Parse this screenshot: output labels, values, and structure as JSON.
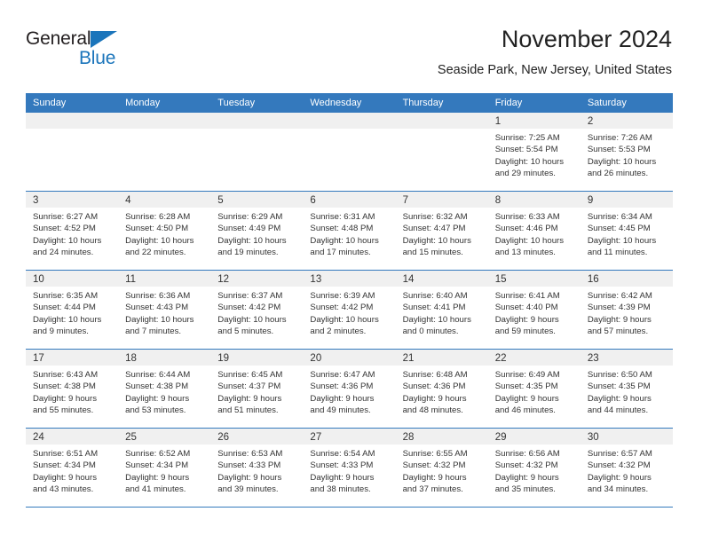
{
  "brand": {
    "name_part1": "General",
    "name_part2": "Blue",
    "accent_color": "#1b75bb",
    "logo_icon": "triangle-icon"
  },
  "header": {
    "title": "November 2024",
    "subtitle": "Seaside Park, New Jersey, United States"
  },
  "calendar": {
    "header_color": "#3479bd",
    "weekdays": [
      "Sunday",
      "Monday",
      "Tuesday",
      "Wednesday",
      "Thursday",
      "Friday",
      "Saturday"
    ],
    "weeks": [
      [
        {
          "day": "",
          "sunrise": "",
          "sunset": "",
          "daylight": "",
          "empty": true
        },
        {
          "day": "",
          "sunrise": "",
          "sunset": "",
          "daylight": "",
          "empty": true
        },
        {
          "day": "",
          "sunrise": "",
          "sunset": "",
          "daylight": "",
          "empty": true
        },
        {
          "day": "",
          "sunrise": "",
          "sunset": "",
          "daylight": "",
          "empty": true
        },
        {
          "day": "",
          "sunrise": "",
          "sunset": "",
          "daylight": "",
          "empty": true
        },
        {
          "day": "1",
          "sunrise": "Sunrise: 7:25 AM",
          "sunset": "Sunset: 5:54 PM",
          "daylight": "Daylight: 10 hours and 29 minutes.",
          "empty": false
        },
        {
          "day": "2",
          "sunrise": "Sunrise: 7:26 AM",
          "sunset": "Sunset: 5:53 PM",
          "daylight": "Daylight: 10 hours and 26 minutes.",
          "empty": false
        }
      ],
      [
        {
          "day": "3",
          "sunrise": "Sunrise: 6:27 AM",
          "sunset": "Sunset: 4:52 PM",
          "daylight": "Daylight: 10 hours and 24 minutes.",
          "empty": false
        },
        {
          "day": "4",
          "sunrise": "Sunrise: 6:28 AM",
          "sunset": "Sunset: 4:50 PM",
          "daylight": "Daylight: 10 hours and 22 minutes.",
          "empty": false
        },
        {
          "day": "5",
          "sunrise": "Sunrise: 6:29 AM",
          "sunset": "Sunset: 4:49 PM",
          "daylight": "Daylight: 10 hours and 19 minutes.",
          "empty": false
        },
        {
          "day": "6",
          "sunrise": "Sunrise: 6:31 AM",
          "sunset": "Sunset: 4:48 PM",
          "daylight": "Daylight: 10 hours and 17 minutes.",
          "empty": false
        },
        {
          "day": "7",
          "sunrise": "Sunrise: 6:32 AM",
          "sunset": "Sunset: 4:47 PM",
          "daylight": "Daylight: 10 hours and 15 minutes.",
          "empty": false
        },
        {
          "day": "8",
          "sunrise": "Sunrise: 6:33 AM",
          "sunset": "Sunset: 4:46 PM",
          "daylight": "Daylight: 10 hours and 13 minutes.",
          "empty": false
        },
        {
          "day": "9",
          "sunrise": "Sunrise: 6:34 AM",
          "sunset": "Sunset: 4:45 PM",
          "daylight": "Daylight: 10 hours and 11 minutes.",
          "empty": false
        }
      ],
      [
        {
          "day": "10",
          "sunrise": "Sunrise: 6:35 AM",
          "sunset": "Sunset: 4:44 PM",
          "daylight": "Daylight: 10 hours and 9 minutes.",
          "empty": false
        },
        {
          "day": "11",
          "sunrise": "Sunrise: 6:36 AM",
          "sunset": "Sunset: 4:43 PM",
          "daylight": "Daylight: 10 hours and 7 minutes.",
          "empty": false
        },
        {
          "day": "12",
          "sunrise": "Sunrise: 6:37 AM",
          "sunset": "Sunset: 4:42 PM",
          "daylight": "Daylight: 10 hours and 5 minutes.",
          "empty": false
        },
        {
          "day": "13",
          "sunrise": "Sunrise: 6:39 AM",
          "sunset": "Sunset: 4:42 PM",
          "daylight": "Daylight: 10 hours and 2 minutes.",
          "empty": false
        },
        {
          "day": "14",
          "sunrise": "Sunrise: 6:40 AM",
          "sunset": "Sunset: 4:41 PM",
          "daylight": "Daylight: 10 hours and 0 minutes.",
          "empty": false
        },
        {
          "day": "15",
          "sunrise": "Sunrise: 6:41 AM",
          "sunset": "Sunset: 4:40 PM",
          "daylight": "Daylight: 9 hours and 59 minutes.",
          "empty": false
        },
        {
          "day": "16",
          "sunrise": "Sunrise: 6:42 AM",
          "sunset": "Sunset: 4:39 PM",
          "daylight": "Daylight: 9 hours and 57 minutes.",
          "empty": false
        }
      ],
      [
        {
          "day": "17",
          "sunrise": "Sunrise: 6:43 AM",
          "sunset": "Sunset: 4:38 PM",
          "daylight": "Daylight: 9 hours and 55 minutes.",
          "empty": false
        },
        {
          "day": "18",
          "sunrise": "Sunrise: 6:44 AM",
          "sunset": "Sunset: 4:38 PM",
          "daylight": "Daylight: 9 hours and 53 minutes.",
          "empty": false
        },
        {
          "day": "19",
          "sunrise": "Sunrise: 6:45 AM",
          "sunset": "Sunset: 4:37 PM",
          "daylight": "Daylight: 9 hours and 51 minutes.",
          "empty": false
        },
        {
          "day": "20",
          "sunrise": "Sunrise: 6:47 AM",
          "sunset": "Sunset: 4:36 PM",
          "daylight": "Daylight: 9 hours and 49 minutes.",
          "empty": false
        },
        {
          "day": "21",
          "sunrise": "Sunrise: 6:48 AM",
          "sunset": "Sunset: 4:36 PM",
          "daylight": "Daylight: 9 hours and 48 minutes.",
          "empty": false
        },
        {
          "day": "22",
          "sunrise": "Sunrise: 6:49 AM",
          "sunset": "Sunset: 4:35 PM",
          "daylight": "Daylight: 9 hours and 46 minutes.",
          "empty": false
        },
        {
          "day": "23",
          "sunrise": "Sunrise: 6:50 AM",
          "sunset": "Sunset: 4:35 PM",
          "daylight": "Daylight: 9 hours and 44 minutes.",
          "empty": false
        }
      ],
      [
        {
          "day": "24",
          "sunrise": "Sunrise: 6:51 AM",
          "sunset": "Sunset: 4:34 PM",
          "daylight": "Daylight: 9 hours and 43 minutes.",
          "empty": false
        },
        {
          "day": "25",
          "sunrise": "Sunrise: 6:52 AM",
          "sunset": "Sunset: 4:34 PM",
          "daylight": "Daylight: 9 hours and 41 minutes.",
          "empty": false
        },
        {
          "day": "26",
          "sunrise": "Sunrise: 6:53 AM",
          "sunset": "Sunset: 4:33 PM",
          "daylight": "Daylight: 9 hours and 39 minutes.",
          "empty": false
        },
        {
          "day": "27",
          "sunrise": "Sunrise: 6:54 AM",
          "sunset": "Sunset: 4:33 PM",
          "daylight": "Daylight: 9 hours and 38 minutes.",
          "empty": false
        },
        {
          "day": "28",
          "sunrise": "Sunrise: 6:55 AM",
          "sunset": "Sunset: 4:32 PM",
          "daylight": "Daylight: 9 hours and 37 minutes.",
          "empty": false
        },
        {
          "day": "29",
          "sunrise": "Sunrise: 6:56 AM",
          "sunset": "Sunset: 4:32 PM",
          "daylight": "Daylight: 9 hours and 35 minutes.",
          "empty": false
        },
        {
          "day": "30",
          "sunrise": "Sunrise: 6:57 AM",
          "sunset": "Sunset: 4:32 PM",
          "daylight": "Daylight: 9 hours and 34 minutes.",
          "empty": false
        }
      ]
    ]
  }
}
